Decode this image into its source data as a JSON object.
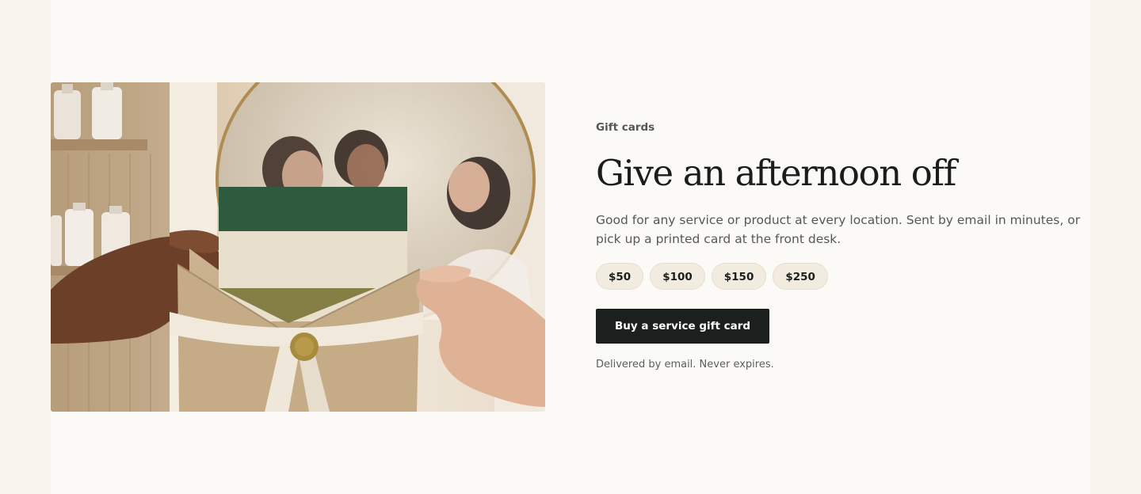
{
  "gift_section": {
    "eyebrow": "Gift cards",
    "headline": "Give an afternoon off",
    "description": "Good for any service or product at every location. Sent by email in minutes, or pick up a printed card at the front desk.",
    "amounts": [
      "$50",
      "$100",
      "$150",
      "$250"
    ],
    "cta_label": "Buy a service gift card",
    "note": "Delivered by email. Never expires."
  },
  "colors": {
    "page_background": "#f9f5ee",
    "section_background": "#fcfaf6",
    "primary_button": "#1b201e",
    "amount_chip": "#f2ebe0",
    "card_green": "#2e5a3d"
  },
  "image": {
    "subject": "hands-holding-gift-card-envelope-photo"
  }
}
